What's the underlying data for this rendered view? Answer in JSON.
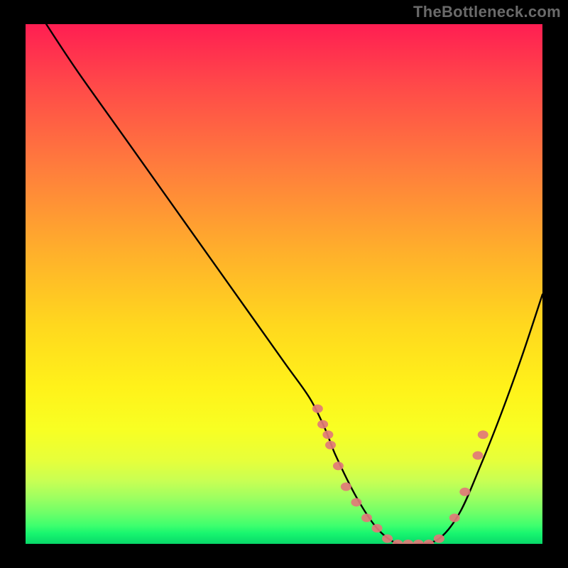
{
  "watermark": "TheBottleneck.com",
  "chart_data": {
    "type": "line",
    "title": "",
    "xlabel": "",
    "ylabel": "",
    "xlim": [
      0,
      100
    ],
    "ylim": [
      0,
      100
    ],
    "series": [
      {
        "name": "curve",
        "x": [
          4,
          10,
          20,
          30,
          40,
          50,
          55,
          58,
          60,
          64,
          68,
          72,
          76,
          80,
          84,
          88,
          92,
          96,
          100
        ],
        "y": [
          100,
          91,
          77,
          63,
          49,
          35,
          28,
          22,
          17,
          9,
          3,
          0,
          0,
          1,
          6,
          15,
          25,
          36,
          48
        ]
      }
    ],
    "markers": {
      "name": "points",
      "color": "#e17a78",
      "x": [
        56.5,
        57.5,
        58.5,
        59.0,
        60.5,
        62.0,
        64.0,
        66.0,
        68.0,
        70.0,
        72.0,
        74.0,
        76.0,
        78.0,
        80.0,
        83.0,
        85.0,
        87.5,
        88.5
      ],
      "y": [
        26,
        23,
        21,
        19,
        15,
        11,
        8,
        5,
        3,
        1,
        0,
        0,
        0,
        0,
        1,
        5,
        10,
        17,
        21
      ]
    }
  }
}
